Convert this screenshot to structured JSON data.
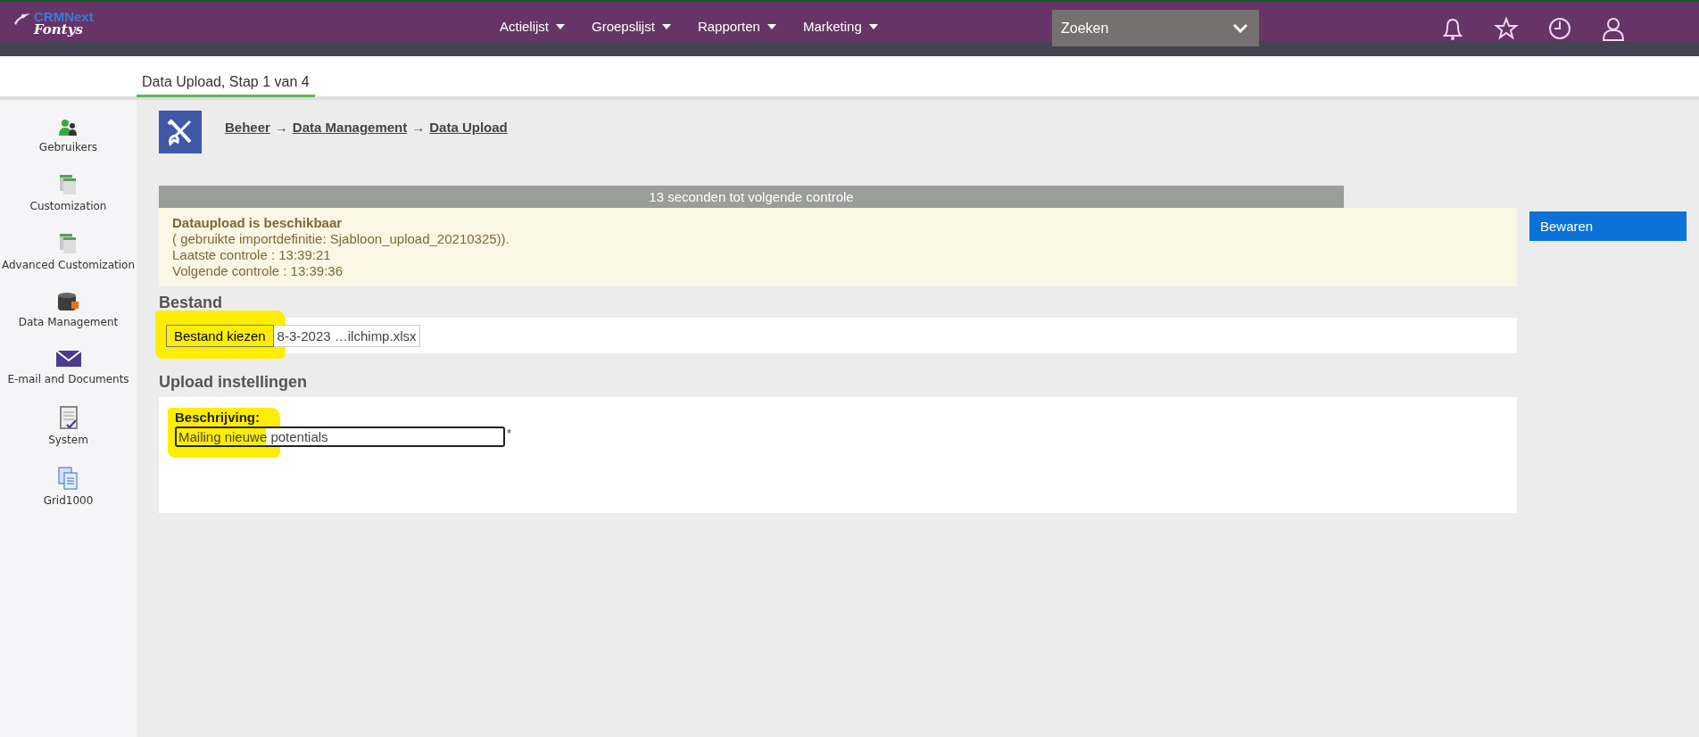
{
  "header": {
    "logo": {
      "brand": "CRMNext",
      "org": "Fontys"
    },
    "menu": [
      {
        "label": "Actielijst"
      },
      {
        "label": "Groepslijst"
      },
      {
        "label": "Rapporten"
      },
      {
        "label": "Marketing"
      }
    ],
    "search": {
      "placeholder": "Zoeken"
    },
    "actions": [
      {
        "kind": "bell"
      },
      {
        "kind": "star"
      },
      {
        "kind": "clock"
      },
      {
        "kind": "user"
      }
    ]
  },
  "tabs": [
    {
      "label": "Data Upload, Stap 1 van 4",
      "selected": true
    }
  ],
  "sidebar": {
    "items": [
      {
        "label": "Gebruikers",
        "kind": "users"
      },
      {
        "label": "Customization",
        "kind": "pages"
      },
      {
        "label": "Advanced Customization",
        "kind": "pages"
      },
      {
        "label": "Data Management",
        "kind": "database"
      },
      {
        "label": "E-mail and Documents",
        "kind": "mail"
      },
      {
        "label": "System",
        "kind": "checklist"
      },
      {
        "label": "Grid1000",
        "kind": "docs"
      }
    ]
  },
  "breadcrumb": [
    {
      "kind": "link",
      "text": "Beheer"
    },
    {
      "kind": "separator",
      "text": "→"
    },
    {
      "kind": "link",
      "text": "Data Management"
    },
    {
      "kind": "separator",
      "text": "→"
    },
    {
      "kind": "link",
      "text": "Data Upload"
    }
  ],
  "countdown": "13 seconden tot volgende controle",
  "status": {
    "title": "Dataupload is beschikbaar",
    "lines": [
      "( gebruikte importdefinitie: Sjabloon_upload_20210325)).",
      "Laatste controle : 13:39:21",
      "Volgende controle : 13:39:36"
    ]
  },
  "save_button": "Bewaren",
  "file_section": {
    "heading": "Bestand",
    "button": "Bestand kiezen",
    "file_name": "8-3-2023 …ilchimp.xlsx",
    "highlighted": true
  },
  "settings_section": {
    "heading": "Upload instellingen",
    "fields": [
      {
        "label": "Beschrijving:",
        "value": "Mailing nieuwe potentials",
        "required_mark": "*",
        "highlighted": true
      }
    ]
  }
}
